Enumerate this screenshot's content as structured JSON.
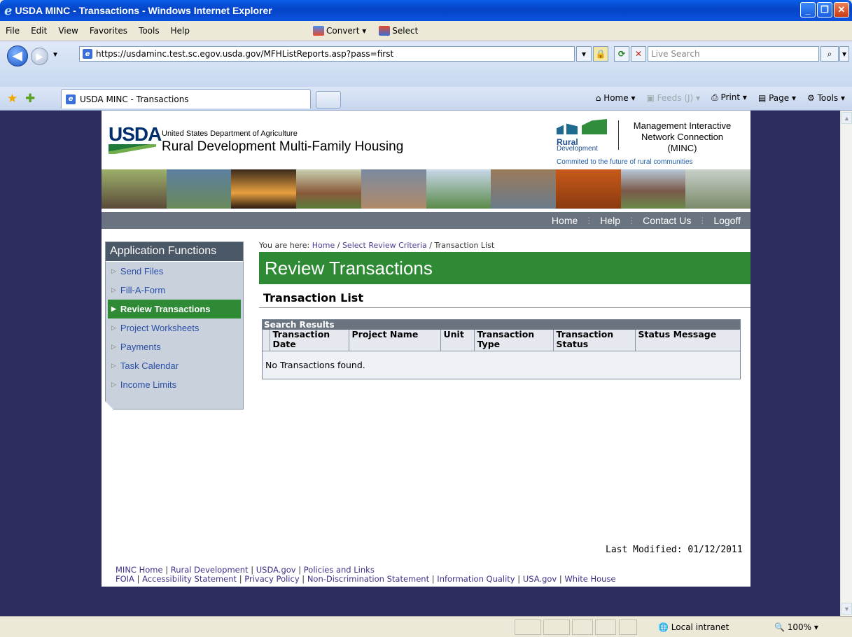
{
  "window": {
    "title": "USDA MINC - Transactions - Windows Internet Explorer"
  },
  "menubar": {
    "items": [
      "File",
      "Edit",
      "View",
      "Favorites",
      "Tools",
      "Help"
    ],
    "convert_label": "Convert",
    "select_label": "Select"
  },
  "address": {
    "url": "https://usdaminc.test.sc.egov.usda.gov/MFHListReports.asp?pass=first",
    "search_placeholder": "Live Search"
  },
  "tabs": {
    "active_tab": "USDA MINC - Transactions"
  },
  "commandbar": {
    "home": "Home",
    "feeds": "Feeds (J)",
    "print": "Print",
    "page": "Page",
    "tools": "Tools"
  },
  "header": {
    "logo_text": "USDA",
    "department": "United States Department of Agriculture",
    "agency": "Rural Development Multi-Family Housing",
    "rd_logo_line1": "Rural",
    "rd_logo_line2": "Development",
    "minc_line1": "Management Interactive",
    "minc_line2": "Network Connection",
    "minc_line3": "(MINC)",
    "tagline": "Commited to the future of rural communities"
  },
  "topnav": {
    "items": [
      "Home",
      "Help",
      "Contact Us",
      "Logoff"
    ]
  },
  "sidebar": {
    "title": "Application Functions",
    "items": [
      {
        "label": "Send Files"
      },
      {
        "label": "Fill-A-Form"
      },
      {
        "label": "Review Transactions"
      },
      {
        "label": "Project Worksheets"
      },
      {
        "label": "Payments"
      },
      {
        "label": "Task Calendar"
      },
      {
        "label": "Income Limits"
      }
    ],
    "active_index": 2
  },
  "breadcrumb": {
    "prefix": "You are here:",
    "home": "Home",
    "criteria": "Select Review Criteria",
    "current": "Transaction List"
  },
  "main": {
    "page_title": "Review Transactions",
    "section_title": "Transaction List",
    "results_title": "Search Results",
    "columns": [
      "Transaction Date",
      "Project Name",
      "Unit",
      "Transaction Type",
      "Transaction Status",
      "Status Message"
    ],
    "empty_message": "No Transactions found.",
    "last_modified": "Last Modified: 01/12/2011"
  },
  "footer": {
    "line1": [
      "MINC Home",
      "Rural Development",
      "USDA.gov",
      "Policies and Links"
    ],
    "line2": [
      "FOIA",
      "Accessibility Statement",
      "Privacy Policy",
      "Non-Discrimination Statement",
      "Information Quality",
      "USA.gov",
      "White House"
    ]
  },
  "statusbar": {
    "zone": "Local intranet",
    "zoom": "100%"
  },
  "colors": {
    "accent_green": "#2e8a35",
    "nav_gray": "#6a7480",
    "page_bg": "#2d2c5e"
  }
}
